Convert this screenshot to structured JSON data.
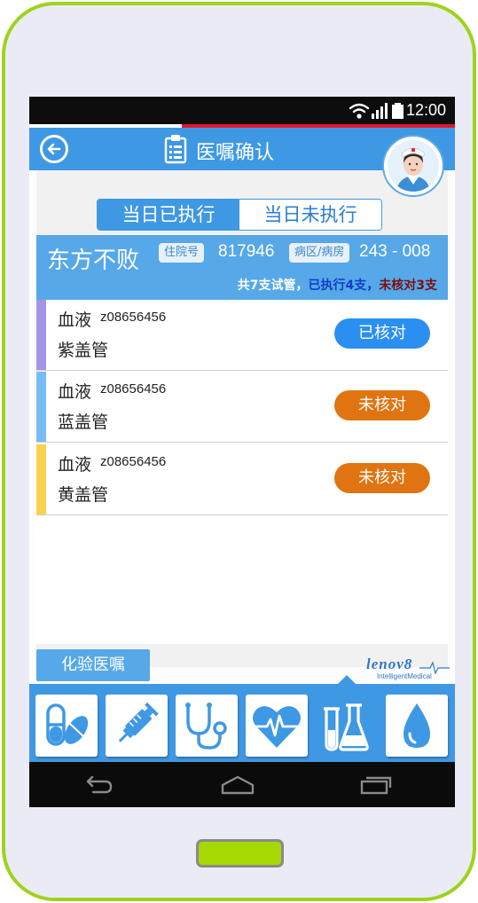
{
  "status_bar": {
    "time": "12:00"
  },
  "header": {
    "title": "医嘱确认"
  },
  "tabs": [
    {
      "label": "当日已执行",
      "active": true
    },
    {
      "label": "当日未执行",
      "active": false
    }
  ],
  "patient": {
    "name": "东方不败",
    "admission_label": "住院号",
    "admission_no": "817946",
    "ward_label": "病区/病房",
    "ward_no": "243 - 008",
    "summary_total": "共7支试管，",
    "summary_executed": "已执行4支，",
    "summary_unchecked": "未核对3支"
  },
  "tubes": [
    {
      "type": "血液",
      "code": "z08656456",
      "tube": "紫盖管",
      "status": "已核对",
      "bar_color": "#a394e8",
      "status_color": "#2a8ff0"
    },
    {
      "type": "血液",
      "code": "z08656456",
      "tube": "蓝盖管",
      "status": "未核对",
      "bar_color": "#79bcf3",
      "status_color": "#e07410"
    },
    {
      "type": "血液",
      "code": "z08656456",
      "tube": "黄盖管",
      "status": "未核对",
      "bar_color": "#f8d24b",
      "status_color": "#e07410"
    }
  ],
  "section_label": "化验医嘱",
  "brand": {
    "name": "lenov8",
    "tagline": "IntelligentMedical"
  },
  "bottom_tabs": [
    {
      "icon": "pill-icon",
      "active": false
    },
    {
      "icon": "syringe-icon",
      "active": false
    },
    {
      "icon": "stethoscope-icon",
      "active": false
    },
    {
      "icon": "heart-pulse-icon",
      "active": false
    },
    {
      "icon": "test-tube-icon",
      "active": true
    },
    {
      "icon": "drop-icon",
      "active": false
    }
  ],
  "colors": {
    "accent": "#3f98e3",
    "frame": "#9ed31b",
    "checked": "#2a8ff0",
    "unchecked": "#e07410"
  }
}
